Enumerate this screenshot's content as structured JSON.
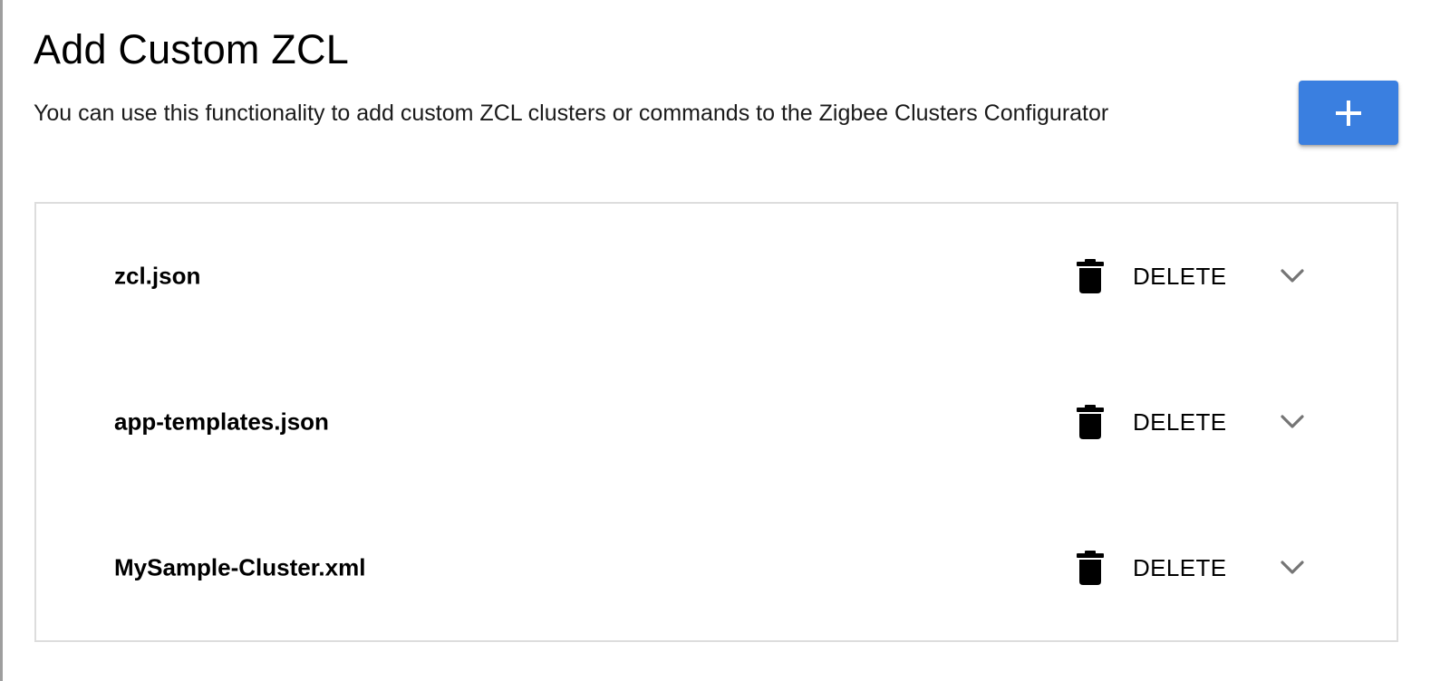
{
  "header": {
    "title": "Add Custom ZCL",
    "description": "You can use this functionality to add custom ZCL clusters or commands to the Zigbee Clusters Configurator"
  },
  "add_button": {
    "icon": "plus-icon",
    "color": "#3a7fe0"
  },
  "files": [
    {
      "name": "zcl.json",
      "delete_label": "DELETE",
      "delete_icon": "trash-icon",
      "expand_icon": "chevron-down-icon"
    },
    {
      "name": "app-templates.json",
      "delete_label": "DELETE",
      "delete_icon": "trash-icon",
      "expand_icon": "chevron-down-icon"
    },
    {
      "name": "MySample-Cluster.xml",
      "delete_label": "DELETE",
      "delete_icon": "trash-icon",
      "expand_icon": "chevron-down-icon"
    }
  ]
}
